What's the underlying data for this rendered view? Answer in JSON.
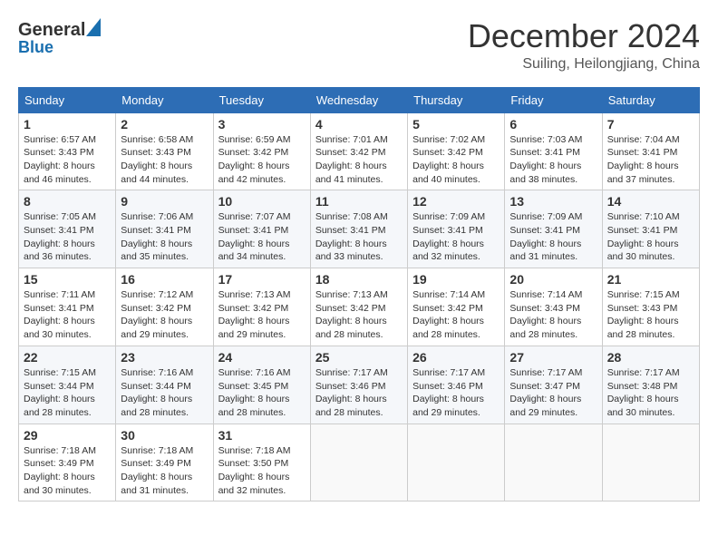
{
  "header": {
    "logo_general": "General",
    "logo_blue": "Blue",
    "month_year": "December 2024",
    "location": "Suiling, Heilongjiang, China"
  },
  "weekdays": [
    "Sunday",
    "Monday",
    "Tuesday",
    "Wednesday",
    "Thursday",
    "Friday",
    "Saturday"
  ],
  "weeks": [
    [
      {
        "day": "1",
        "sunrise": "6:57 AM",
        "sunset": "3:43 PM",
        "daylight": "8 hours and 46 minutes."
      },
      {
        "day": "2",
        "sunrise": "6:58 AM",
        "sunset": "3:43 PM",
        "daylight": "8 hours and 44 minutes."
      },
      {
        "day": "3",
        "sunrise": "6:59 AM",
        "sunset": "3:42 PM",
        "daylight": "8 hours and 42 minutes."
      },
      {
        "day": "4",
        "sunrise": "7:01 AM",
        "sunset": "3:42 PM",
        "daylight": "8 hours and 41 minutes."
      },
      {
        "day": "5",
        "sunrise": "7:02 AM",
        "sunset": "3:42 PM",
        "daylight": "8 hours and 40 minutes."
      },
      {
        "day": "6",
        "sunrise": "7:03 AM",
        "sunset": "3:41 PM",
        "daylight": "8 hours and 38 minutes."
      },
      {
        "day": "7",
        "sunrise": "7:04 AM",
        "sunset": "3:41 PM",
        "daylight": "8 hours and 37 minutes."
      }
    ],
    [
      {
        "day": "8",
        "sunrise": "7:05 AM",
        "sunset": "3:41 PM",
        "daylight": "8 hours and 36 minutes."
      },
      {
        "day": "9",
        "sunrise": "7:06 AM",
        "sunset": "3:41 PM",
        "daylight": "8 hours and 35 minutes."
      },
      {
        "day": "10",
        "sunrise": "7:07 AM",
        "sunset": "3:41 PM",
        "daylight": "8 hours and 34 minutes."
      },
      {
        "day": "11",
        "sunrise": "7:08 AM",
        "sunset": "3:41 PM",
        "daylight": "8 hours and 33 minutes."
      },
      {
        "day": "12",
        "sunrise": "7:09 AM",
        "sunset": "3:41 PM",
        "daylight": "8 hours and 32 minutes."
      },
      {
        "day": "13",
        "sunrise": "7:09 AM",
        "sunset": "3:41 PM",
        "daylight": "8 hours and 31 minutes."
      },
      {
        "day": "14",
        "sunrise": "7:10 AM",
        "sunset": "3:41 PM",
        "daylight": "8 hours and 30 minutes."
      }
    ],
    [
      {
        "day": "15",
        "sunrise": "7:11 AM",
        "sunset": "3:41 PM",
        "daylight": "8 hours and 30 minutes."
      },
      {
        "day": "16",
        "sunrise": "7:12 AM",
        "sunset": "3:42 PM",
        "daylight": "8 hours and 29 minutes."
      },
      {
        "day": "17",
        "sunrise": "7:13 AM",
        "sunset": "3:42 PM",
        "daylight": "8 hours and 29 minutes."
      },
      {
        "day": "18",
        "sunrise": "7:13 AM",
        "sunset": "3:42 PM",
        "daylight": "8 hours and 28 minutes."
      },
      {
        "day": "19",
        "sunrise": "7:14 AM",
        "sunset": "3:42 PM",
        "daylight": "8 hours and 28 minutes."
      },
      {
        "day": "20",
        "sunrise": "7:14 AM",
        "sunset": "3:43 PM",
        "daylight": "8 hours and 28 minutes."
      },
      {
        "day": "21",
        "sunrise": "7:15 AM",
        "sunset": "3:43 PM",
        "daylight": "8 hours and 28 minutes."
      }
    ],
    [
      {
        "day": "22",
        "sunrise": "7:15 AM",
        "sunset": "3:44 PM",
        "daylight": "8 hours and 28 minutes."
      },
      {
        "day": "23",
        "sunrise": "7:16 AM",
        "sunset": "3:44 PM",
        "daylight": "8 hours and 28 minutes."
      },
      {
        "day": "24",
        "sunrise": "7:16 AM",
        "sunset": "3:45 PM",
        "daylight": "8 hours and 28 minutes."
      },
      {
        "day": "25",
        "sunrise": "7:17 AM",
        "sunset": "3:46 PM",
        "daylight": "8 hours and 28 minutes."
      },
      {
        "day": "26",
        "sunrise": "7:17 AM",
        "sunset": "3:46 PM",
        "daylight": "8 hours and 29 minutes."
      },
      {
        "day": "27",
        "sunrise": "7:17 AM",
        "sunset": "3:47 PM",
        "daylight": "8 hours and 29 minutes."
      },
      {
        "day": "28",
        "sunrise": "7:17 AM",
        "sunset": "3:48 PM",
        "daylight": "8 hours and 30 minutes."
      }
    ],
    [
      {
        "day": "29",
        "sunrise": "7:18 AM",
        "sunset": "3:49 PM",
        "daylight": "8 hours and 30 minutes."
      },
      {
        "day": "30",
        "sunrise": "7:18 AM",
        "sunset": "3:49 PM",
        "daylight": "8 hours and 31 minutes."
      },
      {
        "day": "31",
        "sunrise": "7:18 AM",
        "sunset": "3:50 PM",
        "daylight": "8 hours and 32 minutes."
      },
      null,
      null,
      null,
      null
    ]
  ]
}
